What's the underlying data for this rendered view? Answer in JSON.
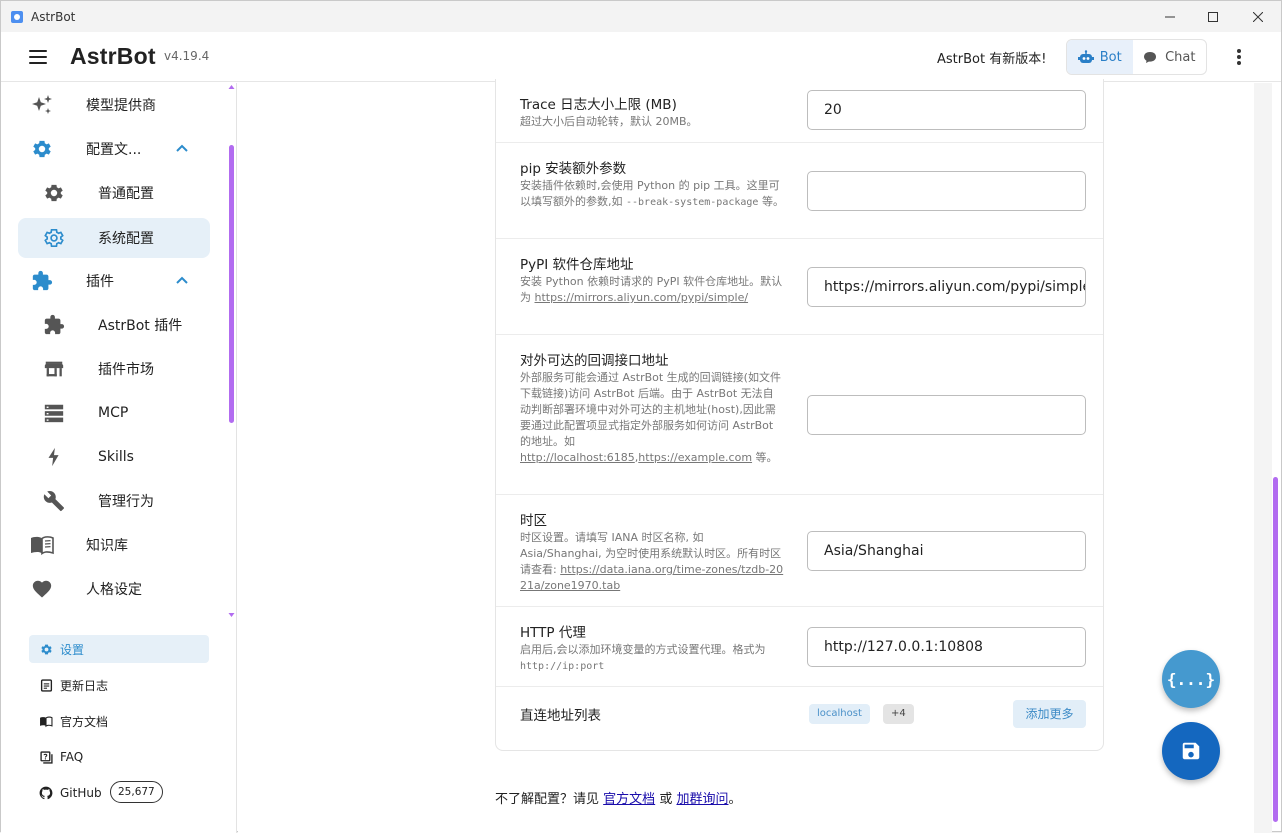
{
  "window": {
    "title": "AstrBot"
  },
  "header": {
    "brand": "AstrBot",
    "version": "v4.19.4",
    "update_notice": "AstrBot 有新版本!",
    "bot_label": "Bot",
    "chat_label": "Chat"
  },
  "sidebar": {
    "items": [
      {
        "label": "模型提供商",
        "icon": "sparkle-icon"
      },
      {
        "label": "配置文...",
        "icon": "gear-icon"
      },
      {
        "label": "普通配置",
        "icon": "gear-icon"
      },
      {
        "label": "系统配置",
        "icon": "gear-outline-icon"
      },
      {
        "label": "插件",
        "icon": "puzzle-icon"
      },
      {
        "label": "AstrBot 插件",
        "icon": "puzzle-icon"
      },
      {
        "label": "插件市场",
        "icon": "store-icon"
      },
      {
        "label": "MCP",
        "icon": "server-icon"
      },
      {
        "label": "Skills",
        "icon": "lightning-icon"
      },
      {
        "label": "管理行为",
        "icon": "wrench-icon"
      },
      {
        "label": "知识库",
        "icon": "book-icon"
      },
      {
        "label": "人格设定",
        "icon": "heart-icon"
      }
    ],
    "bottom": [
      {
        "label": "设置",
        "icon": "gear-icon"
      },
      {
        "label": "更新日志",
        "icon": "changelog-icon"
      },
      {
        "label": "官方文档",
        "icon": "book-icon"
      },
      {
        "label": "FAQ",
        "icon": "faq-icon"
      },
      {
        "label": "GitHub",
        "icon": "github-icon"
      }
    ],
    "github_stars": "25,677",
    "accent": "#2c8ccc"
  },
  "settings": {
    "rows": [
      {
        "title": "Trace 日志大小上限 (MB)",
        "desc": "超过大小后自动轮转，默认 20MB。",
        "value": "20"
      },
      {
        "title": "pip 安装额外参数",
        "desc_a": "安装插件依赖时,会使用 Python 的 pip 工具。这里可以填写额外的参数,如 ",
        "desc_code": "--break-system-package",
        "desc_b": " 等。",
        "value": ""
      },
      {
        "title": "PyPI 软件仓库地址",
        "desc_a": "安装 Python 依赖时请求的 PyPI 软件仓库地址。默认为 ",
        "desc_link": "https://mirrors.aliyun.com/pypi/simple/",
        "value": "https://mirrors.aliyun.com/pypi/simple/"
      },
      {
        "title": "对外可达的回调接口地址",
        "desc_a": "外部服务可能会通过 AstrBot 生成的回调链接(如文件下载链接)访问 AstrBot 后端。由于 AstrBot 无法自动判断部署环境中对外可达的主机地址(host),因此需要通过此配置项显式指定外部服务如何访问 AstrBot 的地址。如 ",
        "desc_link1": "http://localhost:6185",
        "desc_sep": ",",
        "desc_link2": "https://example.com",
        "desc_b": " 等。",
        "value": ""
      },
      {
        "title": "时区",
        "desc_a": "时区设置。请填写 IANA 时区名称, 如 Asia/Shanghai, 为空时使用系统默认时区。所有时区请查看: ",
        "desc_link": "https://data.iana.org/time-zones/tzdb-2021a/zone1970.tab",
        "value": "Asia/Shanghai"
      },
      {
        "title": "HTTP 代理",
        "desc_a": "启用后,会以添加环境变量的方式设置代理。格式为 ",
        "desc_code": "http://ip:port",
        "value": "http://127.0.0.1:10808"
      },
      {
        "title": "直连地址列表",
        "chip": "localhost",
        "chip_more": "+4",
        "add_label": "添加更多"
      }
    ]
  },
  "help": {
    "prefix": "不了解配置？请见",
    "doc_link": "官方文档",
    "or": "或",
    "group_link": "加群询问",
    "suffix": "。"
  },
  "fab": {
    "json_label": "{...}"
  }
}
